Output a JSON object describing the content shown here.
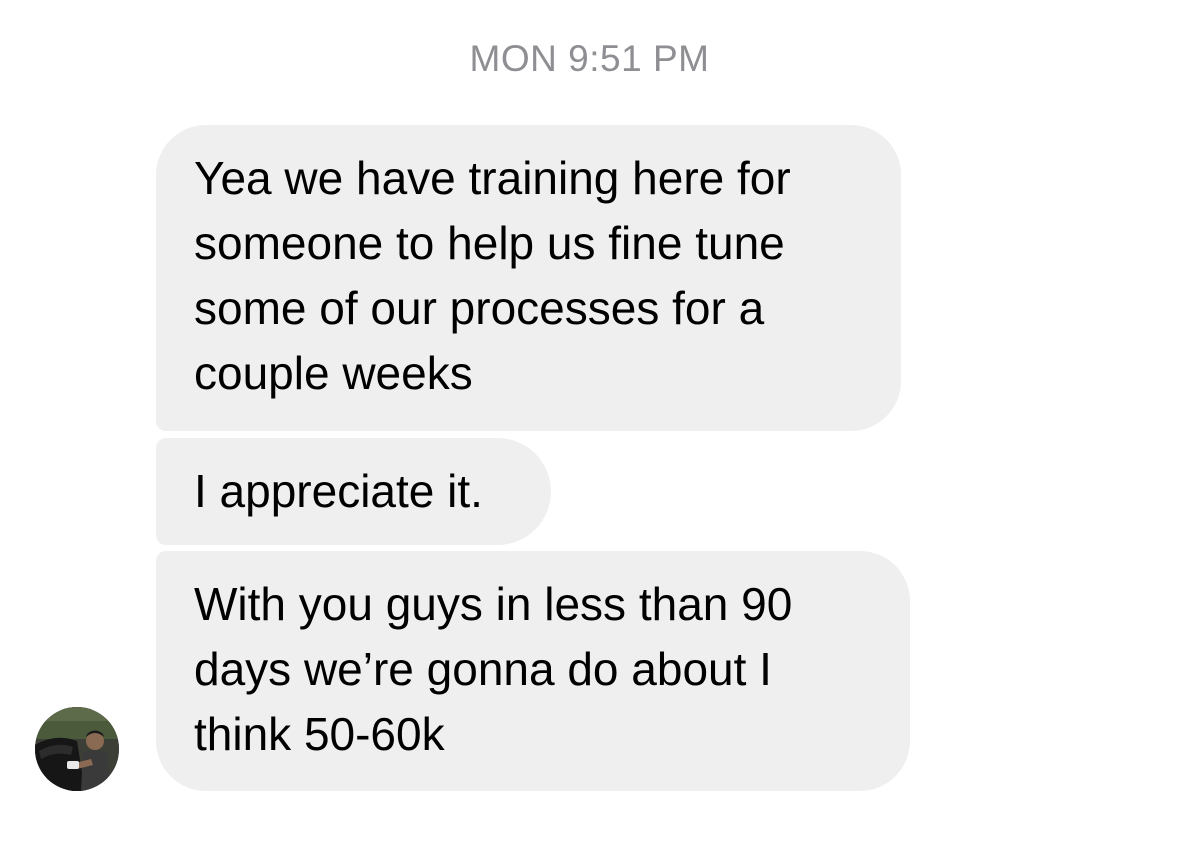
{
  "conversation": {
    "timestamp": "MON 9:51 PM",
    "messages": [
      {
        "lines": [
          "Yea we have training here for",
          "someone to help us fine tune",
          "some of our processes for a",
          "couple weeks"
        ]
      },
      {
        "lines": [
          "I appreciate it."
        ]
      },
      {
        "lines": [
          "With you guys in less than 90",
          "days we’re gonna do about I",
          "think 50-60k"
        ]
      }
    ],
    "avatar": {
      "icon": "contact-avatar-photo"
    }
  },
  "colors": {
    "background": "#ffffff",
    "incoming_bubble": "#efefef",
    "timestamp_text": "#8e8e93",
    "message_text": "#000000"
  }
}
